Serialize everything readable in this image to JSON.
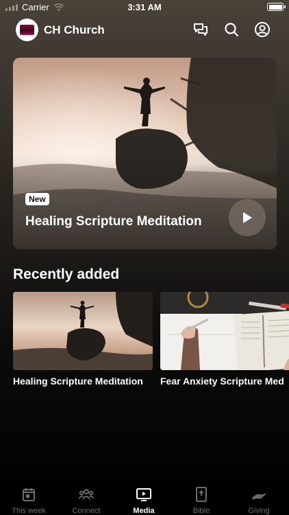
{
  "status_bar": {
    "carrier": "Carrier",
    "time": "3:31 AM"
  },
  "header": {
    "title": "CH Church"
  },
  "hero": {
    "badge": "New",
    "title": "Healing Scripture Meditation"
  },
  "recent": {
    "heading": "Recently added",
    "items": [
      {
        "title": "Healing Scripture Meditation"
      },
      {
        "title": "Fear Anxiety Scripture Med"
      }
    ]
  },
  "tabs": [
    {
      "label": "This week",
      "icon": "calendar-icon"
    },
    {
      "label": "Connect",
      "icon": "people-icon"
    },
    {
      "label": "Media",
      "icon": "play-screen-icon"
    },
    {
      "label": "Bible",
      "icon": "bible-icon"
    },
    {
      "label": "Giving",
      "icon": "hand-icon"
    }
  ],
  "active_tab": "Media"
}
